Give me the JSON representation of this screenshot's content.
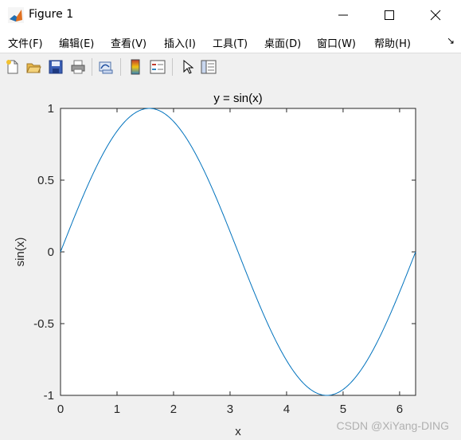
{
  "window": {
    "title": "Figure 1",
    "icon": "matlab-icon",
    "controls": [
      "minimize-icon",
      "maximize-icon",
      "close-icon"
    ]
  },
  "menu": {
    "items": [
      {
        "label": "文件(F)"
      },
      {
        "label": "编辑(E)"
      },
      {
        "label": "查看(V)"
      },
      {
        "label": "插入(I)"
      },
      {
        "label": "工具(T)"
      },
      {
        "label": "桌面(D)"
      },
      {
        "label": "窗口(W)"
      },
      {
        "label": "帮助(H)"
      }
    ],
    "overflow": "↘"
  },
  "toolbar": {
    "buttons": [
      "new-figure-icon",
      "open-icon",
      "save-icon",
      "print-icon",
      "link-plot-icon",
      "colorbar-icon",
      "legend-icon",
      "pointer-icon",
      "property-editor-icon"
    ]
  },
  "plot": {
    "title": "y = sin(x)",
    "xlabel": "x",
    "ylabel": "sin(x)",
    "line_color": "#0072bd"
  },
  "chart_data": {
    "type": "line",
    "title": "y = sin(x)",
    "xlabel": "x",
    "ylabel": "sin(x)",
    "xlim": [
      0,
      6.2832
    ],
    "ylim": [
      -1,
      1
    ],
    "xticks": [
      "0",
      "1",
      "2",
      "3",
      "4",
      "5",
      "6"
    ],
    "yticks": [
      "-1",
      "-0.5",
      "0",
      "0.5",
      "1"
    ],
    "series": [
      {
        "function": "sin(x)",
        "x_start": 0,
        "x_end": 6.2832,
        "color": "#0072bd"
      }
    ],
    "grid": false
  },
  "watermark": "CSDN @XiYang-DING"
}
